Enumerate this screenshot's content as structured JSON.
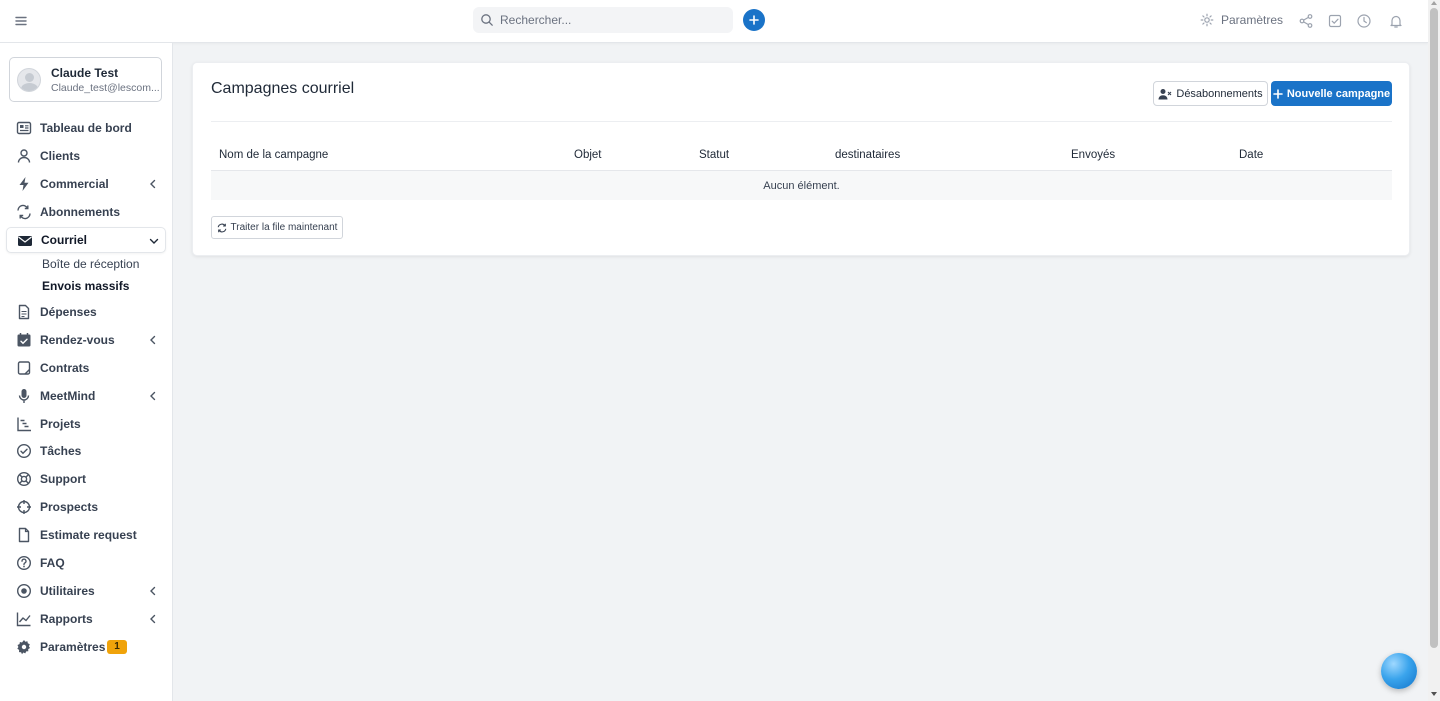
{
  "topbar": {
    "search_placeholder": "Rechercher...",
    "settings_label": "Paramètres"
  },
  "user": {
    "name": "Claude Test",
    "email": "Claude_test@lescom..."
  },
  "sidebar": {
    "items": [
      {
        "label": "Tableau de bord",
        "icon": "dashboard-icon"
      },
      {
        "label": "Clients",
        "icon": "user-icon"
      },
      {
        "label": "Commercial",
        "icon": "bolt-icon"
      },
      {
        "label": "Abonnements",
        "icon": "refresh-icon"
      },
      {
        "label": "Courriel",
        "icon": "envelope-icon"
      },
      {
        "label": "Dépenses",
        "icon": "file-text-icon"
      },
      {
        "label": "Rendez-vous",
        "icon": "calendar-check-icon"
      },
      {
        "label": "Contrats",
        "icon": "contract-icon"
      },
      {
        "label": "MeetMind",
        "icon": "microphone-icon"
      },
      {
        "label": "Projets",
        "icon": "chart-steps-icon"
      },
      {
        "label": "Tâches",
        "icon": "check-circle-icon"
      },
      {
        "label": "Support",
        "icon": "lifebuoy-icon"
      },
      {
        "label": "Prospects",
        "icon": "crosshair-icon"
      },
      {
        "label": "Estimate request",
        "icon": "file-icon"
      },
      {
        "label": "FAQ",
        "icon": "question-circle-icon"
      },
      {
        "label": "Utilitaires",
        "icon": "dot-circle-icon"
      },
      {
        "label": "Rapports",
        "icon": "line-chart-icon"
      },
      {
        "label": "Paramètres",
        "icon": "gear-icon",
        "badge": "1"
      }
    ],
    "courriel_sub": [
      {
        "label": "Boîte de réception"
      },
      {
        "label": "Envois massifs"
      }
    ]
  },
  "main": {
    "title": "Campagnes courriel",
    "unsubscribe_label": "Désabonnements",
    "new_campaign_label": "Nouvelle campagne",
    "columns": [
      "Nom de la campagne",
      "Objet",
      "Statut",
      "destinataires",
      "Envoyés",
      "Date"
    ],
    "empty_text": "Aucun élément.",
    "process_queue_label": "Traiter la file maintenant"
  },
  "colors": {
    "accent": "#1a73c8",
    "badge": "#f0a30a"
  }
}
